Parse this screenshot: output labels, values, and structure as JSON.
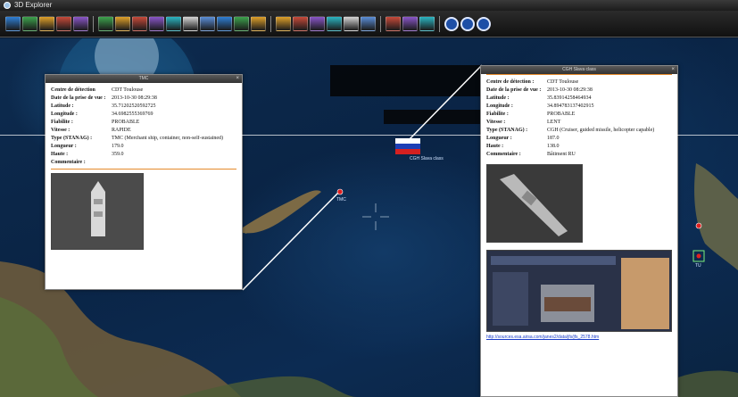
{
  "window": {
    "title": "3D Explorer"
  },
  "toolbar": {
    "groups": [
      [
        "open-icon",
        "save-icon",
        "export-icon",
        "print-icon",
        "settings-icon"
      ],
      [
        "layers-icon",
        "draw-icon",
        "measure-icon",
        "globe-icon",
        "refresh-icon",
        "line-icon",
        "earth-icon",
        "terrain-icon",
        "map-icon",
        "camera-icon"
      ],
      [
        "cursor-icon",
        "select-icon",
        "target-icon",
        "track-icon",
        "filter-icon",
        "chart-icon"
      ],
      [
        "tools-icon",
        "grid-icon",
        "panel-icon"
      ],
      [
        "help-icon",
        "info-icon",
        "stop-icon"
      ]
    ]
  },
  "map": {
    "targets": [
      {
        "label": "TMC"
      },
      {
        "label": "CGH Slava class"
      },
      {
        "label": "TU"
      }
    ]
  },
  "popup_left": {
    "title": "TMC",
    "rows": [
      {
        "k": "Centre de détection",
        "v": "CDT Toulouse"
      },
      {
        "k": "Date de la prise de vue :",
        "v": "2013-10-30 08:29:38"
      },
      {
        "k": "Latitude :",
        "v": "35.71202520592725"
      },
      {
        "k": "Longitude :",
        "v": "34.6982555369769"
      },
      {
        "k": "Fiabilite :",
        "v": "PROBABLE"
      },
      {
        "k": "Vitesse :",
        "v": "RAPIDE"
      },
      {
        "k": "Type (STANAG) :",
        "v": "TMC (Merchant ship, container, non-self-sustained)"
      },
      {
        "k": "Longueur :",
        "v": "179.0"
      },
      {
        "k": "Haute :",
        "v": "359.0"
      },
      {
        "k": "Commentaire :",
        "v": ""
      }
    ]
  },
  "popup_right": {
    "title": "CGH Slava class",
    "rows": [
      {
        "k": "Centre de détection :",
        "v": "CDT Toulouse"
      },
      {
        "k": "Date de la prise de vue :",
        "v": "2013-10-30 08:29:38"
      },
      {
        "k": "Latitude :",
        "v": "35.83914258464934"
      },
      {
        "k": "Longitude :",
        "v": "34.894783137402915"
      },
      {
        "k": "Fiabilite :",
        "v": "PROBABLE"
      },
      {
        "k": "Vitesse :",
        "v": "LENT"
      },
      {
        "k": "Type (STANAG) :",
        "v": "CGH (Cruiser, guided missile, helicopter capable)"
      },
      {
        "k": "Longueur :",
        "v": "187.0"
      },
      {
        "k": "Haute :",
        "v": "138.0"
      },
      {
        "k": "Commentaire :",
        "v": "Bâtiment RU"
      }
    ],
    "link": "http://sources.esa.airsa.com/janes2/data/jfs/jfs_2578.htm"
  }
}
